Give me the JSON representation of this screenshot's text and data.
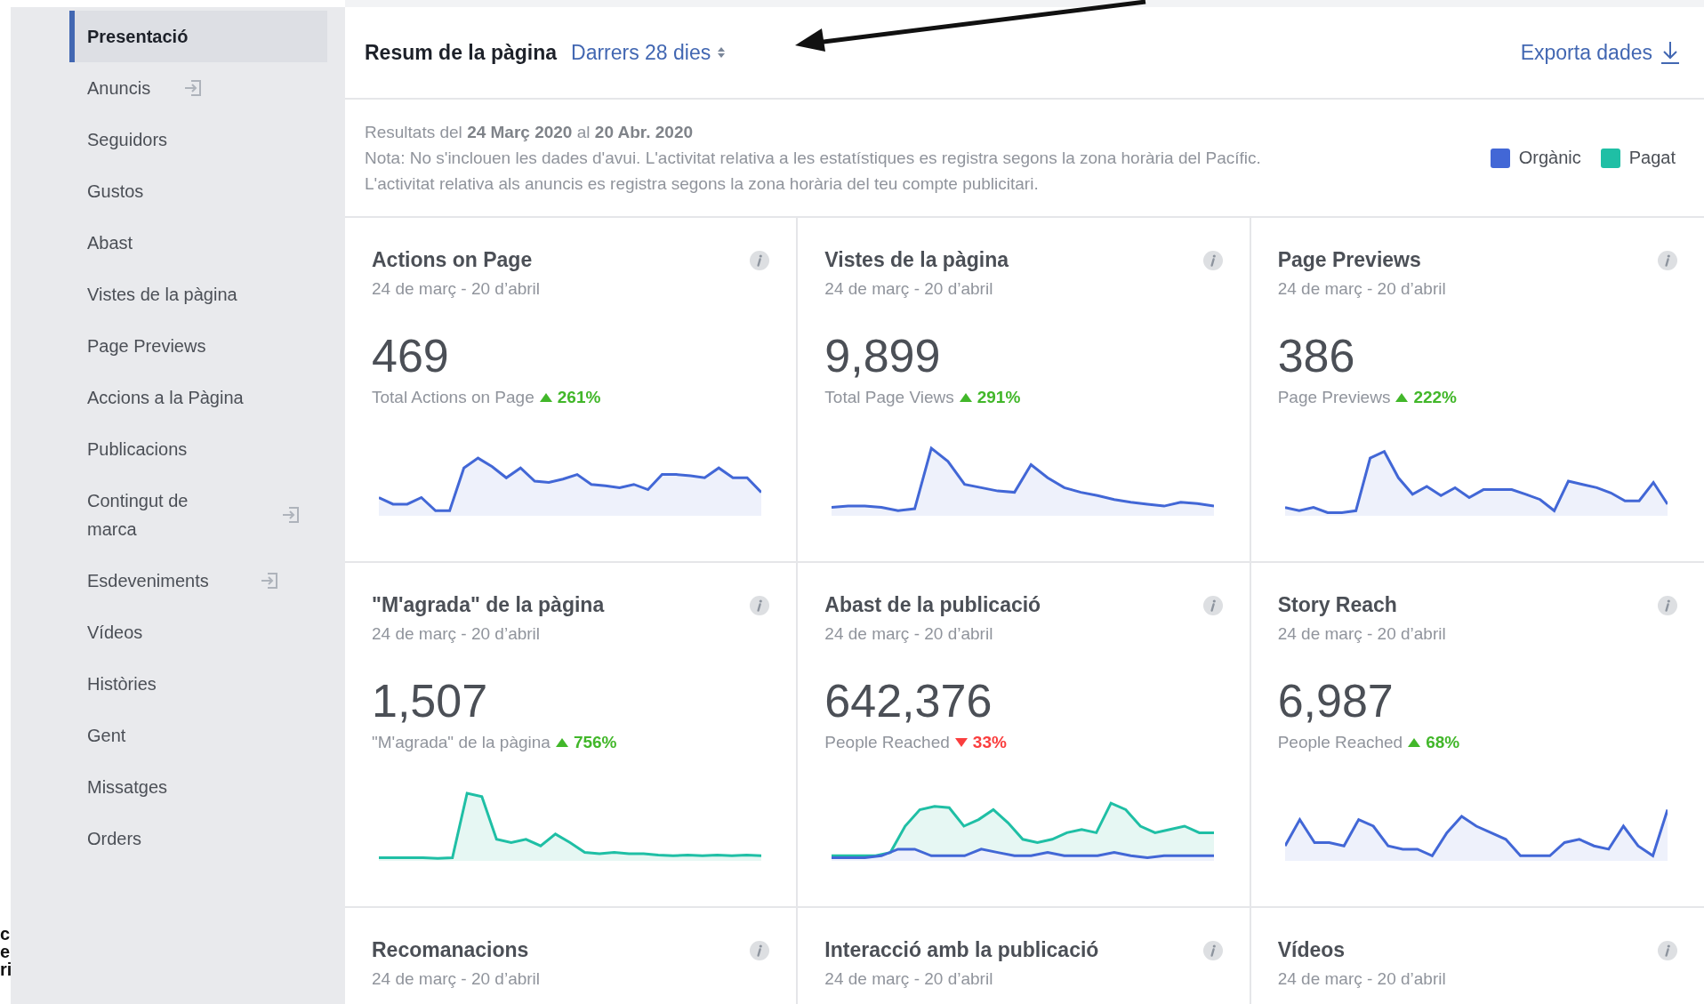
{
  "sidebar": {
    "items": [
      {
        "label": "Presentació",
        "selected": true,
        "external": false
      },
      {
        "label": "Anuncis",
        "selected": false,
        "external": true
      },
      {
        "label": "Seguidors",
        "selected": false,
        "external": false
      },
      {
        "label": "Gustos",
        "selected": false,
        "external": false
      },
      {
        "label": "Abast",
        "selected": false,
        "external": false
      },
      {
        "label": "Vistes de la pàgina",
        "selected": false,
        "external": false
      },
      {
        "label": "Page Previews",
        "selected": false,
        "external": false
      },
      {
        "label": "Accions a la Pàgina",
        "selected": false,
        "external": false
      },
      {
        "label": "Publicacions",
        "selected": false,
        "external": false
      },
      {
        "label": "Contingut de marca",
        "selected": false,
        "external": true
      },
      {
        "label": "Esdeveniments",
        "selected": false,
        "external": true
      },
      {
        "label": "Vídeos",
        "selected": false,
        "external": false
      },
      {
        "label": "Històries",
        "selected": false,
        "external": false
      },
      {
        "label": "Gent",
        "selected": false,
        "external": false
      },
      {
        "label": "Missatges",
        "selected": false,
        "external": false
      },
      {
        "label": "Orders",
        "selected": false,
        "external": false
      }
    ],
    "edge_fragments": [
      "c",
      "e",
      "ri"
    ]
  },
  "header": {
    "title": "Resum de la pàgina",
    "period": "Darrers 28 dies",
    "export": "Exporta dades"
  },
  "info": {
    "results": "Resultats del **24 Març 2020** al **20 Abr. 2020**",
    "note": "Nota: No s'inclouen les dades d'avui. L'activitat relativa a les estatístiques es registra segons la zona horària del Pacífic.",
    "note2": "L'activitat relativa als anuncis es registra segons la zona horària del teu compte publicitari.",
    "legend": [
      {
        "label": "Orgànic",
        "color": "#4267d6"
      },
      {
        "label": "Pagat",
        "color": "#1fbfa5"
      }
    ]
  },
  "cards": [
    {
      "title": "Actions on Page",
      "range": "24 de març - 20 d’abril",
      "value": "469",
      "caption": "Total Actions on Page",
      "rising": true,
      "change": "261%",
      "lines": [
        {
          "kind": "organic"
        }
      ]
    },
    {
      "title": "Vistes de la pàgina",
      "range": "24 de març - 20 d’abril",
      "value": "9,899",
      "caption": "Total Page Views",
      "rising": true,
      "change": "291%",
      "lines": [
        {
          "kind": "organic"
        }
      ]
    },
    {
      "title": "Page Previews",
      "range": "24 de març - 20 d’abril",
      "value": "386",
      "caption": "Page Previews",
      "rising": true,
      "change": "222%",
      "lines": [
        {
          "kind": "organic"
        }
      ]
    },
    {
      "title": "\"M'agrada\" de la pàgina",
      "range": "24 de març - 20 d’abril",
      "value": "1,507",
      "caption": "\"M'agrada\" de la pàgina",
      "rising": true,
      "change": "756%",
      "lines": [
        {
          "kind": "paid"
        }
      ]
    },
    {
      "title": "Abast de la publicació",
      "range": "24 de març - 20 d’abril",
      "value": "642,376",
      "caption": "People Reached",
      "rising": false,
      "change": "33%",
      "lines": [
        {
          "kind": "paid"
        },
        {
          "kind": "organic"
        }
      ]
    },
    {
      "title": "Story Reach",
      "range": "24 de març - 20 d’abril",
      "value": "6,987",
      "caption": "People Reached",
      "rising": true,
      "change": "68%",
      "lines": [
        {
          "kind": "organic"
        }
      ]
    },
    {
      "title": "Recomanacions",
      "range": "24 de març - 20 d’abril"
    },
    {
      "title": "Interacció amb la publicació",
      "range": "24 de març - 20 d’abril"
    },
    {
      "title": "Vídeos",
      "range": "24 de març - 20 d’abril"
    }
  ]
}
